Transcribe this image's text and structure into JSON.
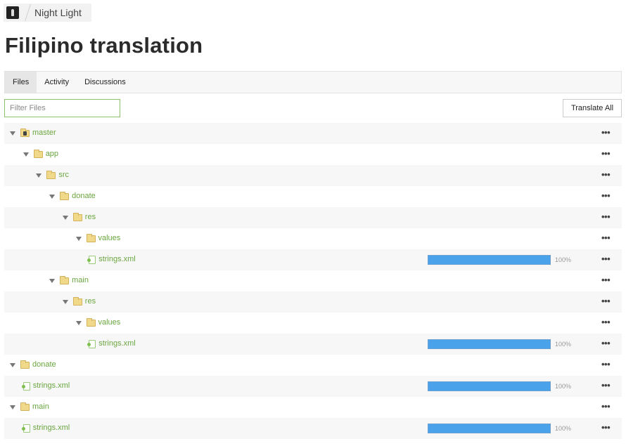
{
  "breadcrumb": {
    "project": "Night Light"
  },
  "page": {
    "title": "Filipino translation"
  },
  "tabs": [
    {
      "label": "Files",
      "active": true
    },
    {
      "label": "Activity",
      "active": false
    },
    {
      "label": "Discussions",
      "active": false
    }
  ],
  "filter": {
    "placeholder": "Filter Files",
    "value": ""
  },
  "actions": {
    "translate_all": "Translate All"
  },
  "colors": {
    "accent_green": "#6aa53f",
    "progress_blue": "#4aa3ea"
  },
  "tree": [
    {
      "type": "branch",
      "name": "master",
      "depth": 0,
      "expanded": true
    },
    {
      "type": "folder",
      "name": "app",
      "depth": 1,
      "expanded": true
    },
    {
      "type": "folder",
      "name": "src",
      "depth": 2,
      "expanded": true
    },
    {
      "type": "folder",
      "name": "donate",
      "depth": 3,
      "expanded": true
    },
    {
      "type": "folder",
      "name": "res",
      "depth": 4,
      "expanded": true
    },
    {
      "type": "folder",
      "name": "values",
      "depth": 5,
      "expanded": true
    },
    {
      "type": "file",
      "name": "strings.xml",
      "depth": 6,
      "progress": 100,
      "progress_label": "100%"
    },
    {
      "type": "folder",
      "name": "main",
      "depth": 3,
      "expanded": true
    },
    {
      "type": "folder",
      "name": "res",
      "depth": 4,
      "expanded": true
    },
    {
      "type": "folder",
      "name": "values",
      "depth": 5,
      "expanded": true
    },
    {
      "type": "file",
      "name": "strings.xml",
      "depth": 6,
      "progress": 100,
      "progress_label": "100%"
    },
    {
      "type": "folder",
      "name": "donate",
      "depth": 0,
      "expanded": true
    },
    {
      "type": "file",
      "name": "strings.xml",
      "depth": 1,
      "progress": 100,
      "progress_label": "100%"
    },
    {
      "type": "folder",
      "name": "main",
      "depth": 0,
      "expanded": true
    },
    {
      "type": "file",
      "name": "strings.xml",
      "depth": 1,
      "progress": 100,
      "progress_label": "100%"
    }
  ],
  "row_menu": {
    "label": "•••"
  }
}
